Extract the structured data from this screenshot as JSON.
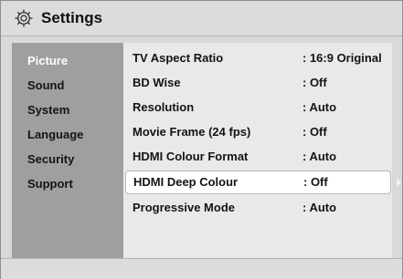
{
  "header": {
    "title": "Settings",
    "icon": "gear-icon"
  },
  "sidebar": {
    "items": [
      {
        "label": "Picture",
        "active": true
      },
      {
        "label": "Sound"
      },
      {
        "label": "System"
      },
      {
        "label": "Language"
      },
      {
        "label": "Security"
      },
      {
        "label": "Support"
      }
    ]
  },
  "main": {
    "rows": [
      {
        "label": "TV Aspect Ratio",
        "value": ": 16:9 Original"
      },
      {
        "label": "BD Wise",
        "value": ": Off"
      },
      {
        "label": "Resolution",
        "value": ": Auto"
      },
      {
        "label": "Movie Frame (24 fps)",
        "value": ": Off"
      },
      {
        "label": "HDMI Colour Format",
        "value": ": Auto"
      },
      {
        "label": "HDMI Deep Colour",
        "value": ": Off",
        "focused": true
      },
      {
        "label": "Progressive Mode",
        "value": ": Auto"
      }
    ]
  },
  "colors": {
    "sidebar_bg": "#9f9f9f",
    "main_bg": "#e9e9e9",
    "active_text": "#ffffff",
    "focus_bg": "#ffffff"
  }
}
